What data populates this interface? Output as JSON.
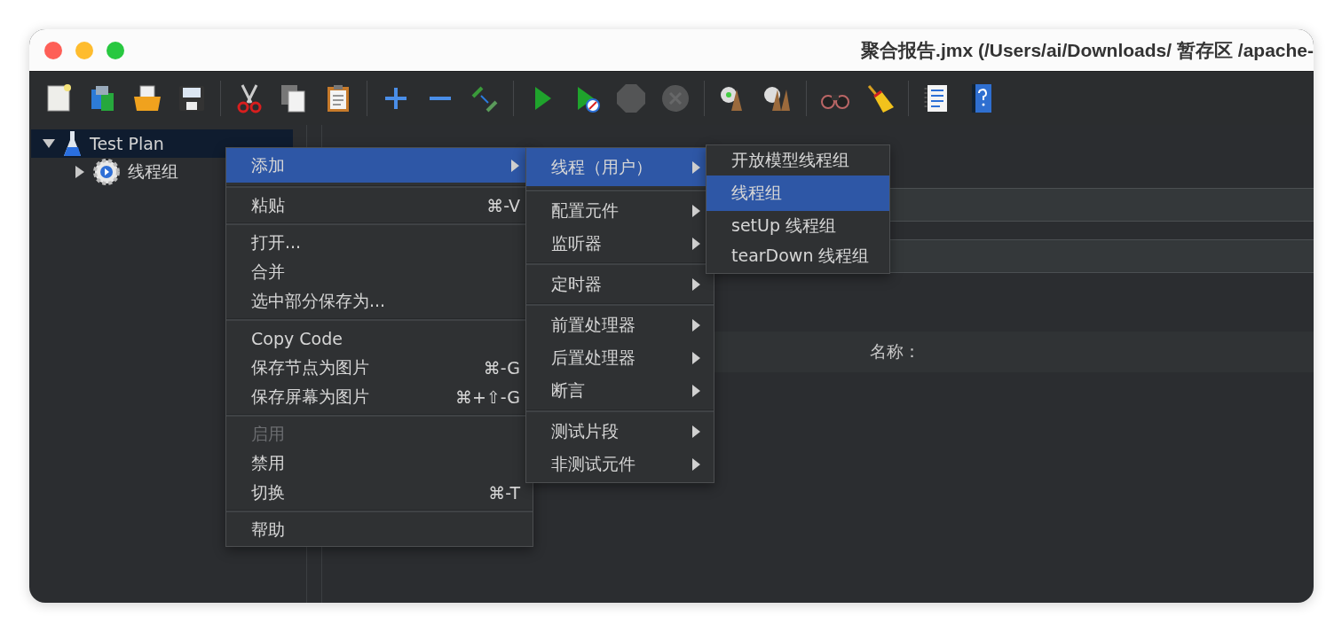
{
  "window": {
    "title": "聚合报告.jmx (/Users/ai/Downloads/ 暂存区 /apache-"
  },
  "toolbar": [
    {
      "kind": "new",
      "disabled": false
    },
    {
      "kind": "templates",
      "disabled": false
    },
    {
      "kind": "open",
      "disabled": false
    },
    {
      "kind": "save",
      "disabled": false
    },
    {
      "kind": "separator"
    },
    {
      "kind": "cut",
      "disabled": false
    },
    {
      "kind": "copy",
      "disabled": false
    },
    {
      "kind": "paste",
      "disabled": false
    },
    {
      "kind": "separator"
    },
    {
      "kind": "expand",
      "disabled": false
    },
    {
      "kind": "collapse",
      "disabled": false
    },
    {
      "kind": "toggle",
      "disabled": false
    },
    {
      "kind": "separator"
    },
    {
      "kind": "start",
      "disabled": false
    },
    {
      "kind": "start_no_pause",
      "disabled": false
    },
    {
      "kind": "stop",
      "disabled": true
    },
    {
      "kind": "shutdown",
      "disabled": true
    },
    {
      "kind": "separator"
    },
    {
      "kind": "clear",
      "disabled": false
    },
    {
      "kind": "clear_all",
      "disabled": false
    },
    {
      "kind": "separator"
    },
    {
      "kind": "search",
      "disabled": false
    },
    {
      "kind": "reset_search",
      "disabled": false
    },
    {
      "kind": "separator"
    },
    {
      "kind": "log",
      "disabled": false
    },
    {
      "kind": "help",
      "disabled": false
    }
  ],
  "tree": [
    {
      "label": "Test Plan",
      "kind": "plan",
      "selected": true,
      "expanded": true,
      "children": [
        {
          "label": "线程组",
          "kind": "thread_group",
          "selected": false,
          "expanded": false
        }
      ]
    }
  ],
  "panel": {
    "name_label": "名称："
  },
  "context_menu": [
    {
      "kind": "item",
      "label": "添加",
      "selected": true,
      "disabled": false,
      "submenu": true
    },
    {
      "kind": "separator"
    },
    {
      "kind": "item",
      "label": "粘贴",
      "shortcut": "⌘-V",
      "selected": false,
      "disabled": false,
      "submenu": false
    },
    {
      "kind": "separator"
    },
    {
      "kind": "item",
      "label": "打开...",
      "selected": false,
      "disabled": false,
      "submenu": false
    },
    {
      "kind": "item",
      "label": "合并",
      "selected": false,
      "disabled": false,
      "submenu": false
    },
    {
      "kind": "item",
      "label": "选中部分保存为...",
      "selected": false,
      "disabled": false,
      "submenu": false
    },
    {
      "kind": "separator"
    },
    {
      "kind": "item",
      "label": "Copy Code",
      "selected": false,
      "disabled": false,
      "submenu": false
    },
    {
      "kind": "item",
      "label": "保存节点为图片",
      "shortcut": "⌘-G",
      "selected": false,
      "disabled": false,
      "submenu": false
    },
    {
      "kind": "item",
      "label": "保存屏幕为图片",
      "shortcut": "⌘+⇧-G",
      "selected": false,
      "disabled": false,
      "submenu": false
    },
    {
      "kind": "separator"
    },
    {
      "kind": "item",
      "label": "启用",
      "selected": false,
      "disabled": true,
      "submenu": false
    },
    {
      "kind": "item",
      "label": "禁用",
      "selected": false,
      "disabled": false,
      "submenu": false
    },
    {
      "kind": "item",
      "label": "切换",
      "shortcut": "⌘-T",
      "selected": false,
      "disabled": false,
      "submenu": false
    },
    {
      "kind": "separator"
    },
    {
      "kind": "item",
      "label": "帮助",
      "selected": false,
      "disabled": false,
      "submenu": false
    }
  ],
  "add_submenu": [
    {
      "kind": "item",
      "label": "线程（用户）",
      "selected": true,
      "disabled": false,
      "submenu": true
    },
    {
      "kind": "separator"
    },
    {
      "kind": "item",
      "label": "配置元件",
      "selected": false,
      "disabled": false,
      "submenu": true
    },
    {
      "kind": "item",
      "label": "监听器",
      "selected": false,
      "disabled": false,
      "submenu": true
    },
    {
      "kind": "separator"
    },
    {
      "kind": "item",
      "label": "定时器",
      "selected": false,
      "disabled": false,
      "submenu": true
    },
    {
      "kind": "separator"
    },
    {
      "kind": "item",
      "label": "前置处理器",
      "selected": false,
      "disabled": false,
      "submenu": true
    },
    {
      "kind": "item",
      "label": "后置处理器",
      "selected": false,
      "disabled": false,
      "submenu": true
    },
    {
      "kind": "item",
      "label": "断言",
      "selected": false,
      "disabled": false,
      "submenu": true
    },
    {
      "kind": "separator"
    },
    {
      "kind": "item",
      "label": "测试片段",
      "selected": false,
      "disabled": false,
      "submenu": true
    },
    {
      "kind": "item",
      "label": "非测试元件",
      "selected": false,
      "disabled": false,
      "submenu": true
    }
  ],
  "threads_submenu": [
    {
      "kind": "item",
      "label": "开放模型线程组",
      "selected": false,
      "disabled": false,
      "submenu": false
    },
    {
      "kind": "item",
      "label": "线程组",
      "selected": true,
      "disabled": false,
      "submenu": false
    },
    {
      "kind": "item",
      "label": "setUp 线程组",
      "selected": false,
      "disabled": false,
      "submenu": false
    },
    {
      "kind": "item",
      "label": "tearDown 线程组",
      "selected": false,
      "disabled": false,
      "submenu": false
    }
  ]
}
